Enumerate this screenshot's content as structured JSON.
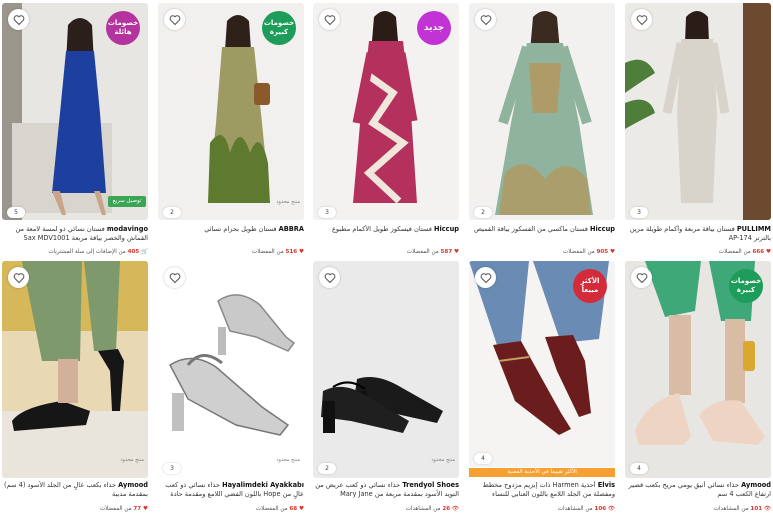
{
  "products": [
    {
      "brand": "modavingo",
      "title": "فستان نسائي ذو لمسة لامعة من القماش والخصر بياقة مربعة Sax MDV1001",
      "count": "5",
      "badge": "خصومات هائلة",
      "badge_color": "#b4339c",
      "express": "توصيل سريع",
      "stat_number": "405",
      "stat_text": "من الإضافات إلى سلة المشتريات",
      "stat_icon": "cart-icon"
    },
    {
      "brand": "ABBRA",
      "title": "فستان طويل بحزام نسائي",
      "count": "2",
      "badge": "خصومات كبيرة",
      "badge_color": "#1d9c5a",
      "small_label": "منتج محدود",
      "stat_number": "516",
      "stat_text": "من المفضلات",
      "stat_icon": "heart-icon"
    },
    {
      "brand": "Hiccup",
      "title": "فستان فيسكوز طويل الأكمام مطبوع",
      "count": "3",
      "badge": "جديد",
      "badge_color": "#c233d6",
      "stat_number": "587",
      "stat_text": "من المفضلات",
      "stat_icon": "heart-icon"
    },
    {
      "brand": "Hiccup",
      "title": "فستان ماكسي من الفسكوز بياقة القميص",
      "count": "2",
      "stat_number": "905",
      "stat_text": "من المفضلات",
      "stat_icon": "heart-icon"
    },
    {
      "brand": "PULLIMM",
      "title": "فستان بياقة مربعة وأكمام طويلة مزين بالترتر AP-174",
      "count": "3",
      "stat_number": "666",
      "stat_text": "من المفضلات",
      "stat_icon": "heart-icon"
    },
    {
      "brand": "Aymood",
      "title": "حذاء بكعب عالٍ من الجلد الأسود (4 سم) بمقدمة مدببة",
      "count": "",
      "small_label": "منتج محدود",
      "stat_number": "77",
      "stat_text": "من المفضلات",
      "stat_icon": "heart-icon"
    },
    {
      "brand": "Hayalimdeki Ayakkabı",
      "title": "حذاء نسائي ذو كعب عالٍ من Hope باللون الفضي اللامع ومقدمة حادة",
      "count": "3",
      "small_label": "منتج محدود",
      "stat_number": "68",
      "stat_text": "من المفضلات",
      "stat_icon": "heart-icon"
    },
    {
      "brand": "Trendyol Shoes",
      "title": "حذاء نسائي ذو كعب عريض من التويد الأسود بمقدمة مربعة من Mary Jane",
      "count": "2",
      "small_label": "منتج محدود",
      "stat_number": "26",
      "stat_text": "من المشاهدات",
      "stat_icon": "eye-icon"
    },
    {
      "brand": "Elvis",
      "title": "أحذية Harmen ذات إبزيم مزدوج مخطط ومفصلة من الجلد اللامع باللون العنابي للنساء",
      "count": "4",
      "badge": "الأكثر مبيعاً",
      "badge_color": "#d42b3a",
      "promo": "الأكثر تقييماً في الأحذية الفضية",
      "stat_number": "106",
      "stat_text": "من المشاهدات",
      "stat_icon": "eye-icon"
    },
    {
      "brand": "Aymood",
      "title": "حذاء نسائي أنيق يومي مريح بكعب قصير ارتفاع الكعب 4 سم",
      "count": "4",
      "badge": "خصومات كبيرة",
      "badge_color": "#1d9c5a",
      "stat_number": "101",
      "stat_text": "من المشاهدات",
      "stat_icon": "eye-icon"
    }
  ]
}
